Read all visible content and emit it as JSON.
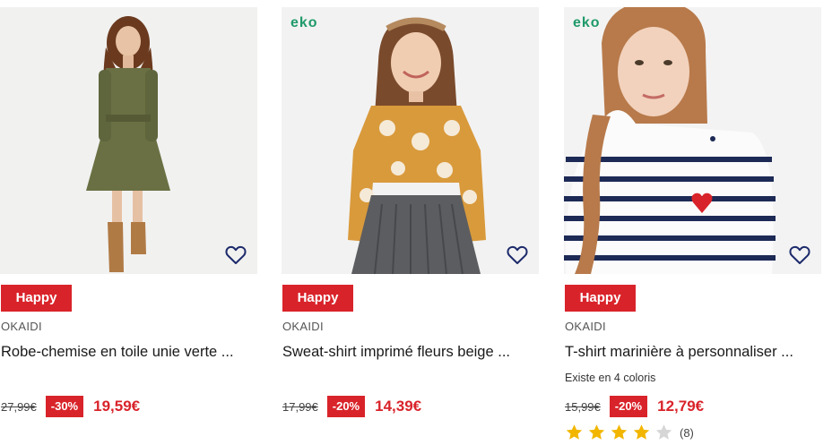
{
  "products": [
    {
      "eko": "",
      "badge": "Happy",
      "brand": "OKAIDI",
      "title": "Robe-chemise en toile unie verte ...",
      "colors": "",
      "old_price": "27,99€",
      "discount": "-30%",
      "price": "19,59€"
    },
    {
      "eko": "eko",
      "badge": "Happy",
      "brand": "OKAIDI",
      "title": "Sweat-shirt imprimé fleurs beige ...",
      "colors": "",
      "old_price": "17,99€",
      "discount": "-20%",
      "price": "14,39€"
    },
    {
      "eko": "eko",
      "badge": "Happy",
      "brand": "OKAIDI",
      "title": "T-shirt marinière à personnaliser ...",
      "colors": "Existe en 4 coloris",
      "old_price": "15,99€",
      "discount": "-20%",
      "price": "12,79€",
      "rating": 4,
      "rating_max": 5,
      "review_count": "(8)"
    }
  ],
  "theme": {
    "promo_red": "#d9232a",
    "eko_green": "#1f9a6a",
    "heart_navy": "#1c2a6b",
    "star_gold": "#f2b600",
    "star_empty": "#d6d6d6"
  },
  "icons": {
    "wishlist": "heart-outline-icon",
    "rating": "star-icon"
  }
}
